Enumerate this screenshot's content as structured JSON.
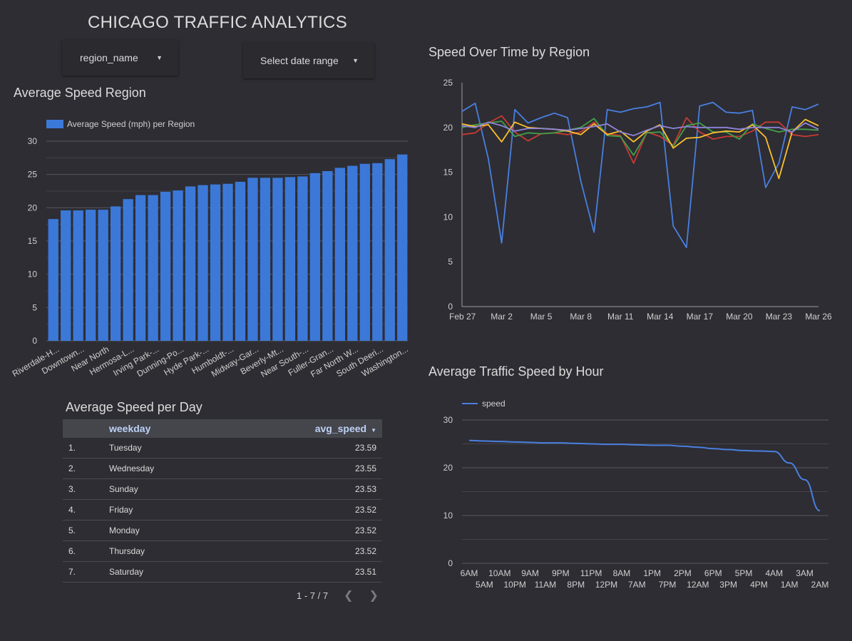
{
  "title": "CHICAGO TRAFFIC ANALYTICS",
  "filters": {
    "region": {
      "label": "region_name"
    },
    "date": {
      "label": "Select date range"
    }
  },
  "region_chart": {
    "title": "Average Speed Region",
    "legend": "Average Speed (mph) per Region",
    "color": "#3c78d8"
  },
  "time_chart": {
    "title": "Speed Over Time by Region"
  },
  "hour_chart": {
    "title": "Average Traffic Speed by Hour",
    "legend": "speed"
  },
  "table": {
    "title": "Average Speed per Day",
    "headers": {
      "day": "weekday",
      "value": "avg_speed"
    },
    "rows": [
      {
        "idx": "1.",
        "day": "Tuesday",
        "value": "23.59"
      },
      {
        "idx": "2.",
        "day": "Wednesday",
        "value": "23.55"
      },
      {
        "idx": "3.",
        "day": "Sunday",
        "value": "23.53"
      },
      {
        "idx": "4.",
        "day": "Friday",
        "value": "23.52"
      },
      {
        "idx": "5.",
        "day": "Monday",
        "value": "23.52"
      },
      {
        "idx": "6.",
        "day": "Thursday",
        "value": "23.52"
      },
      {
        "idx": "7.",
        "day": "Saturday",
        "value": "23.51"
      }
    ],
    "pagination": "1 - 7 / 7"
  },
  "icons": {
    "dropdown": "caret-down-icon",
    "prev": "chevron-left-icon",
    "next": "chevron-right-icon",
    "sort": "sort-desc-icon"
  },
  "chart_data": [
    {
      "type": "bar",
      "title": "Average Speed Region",
      "legend": [
        "Average Speed (mph) per Region"
      ],
      "ylim": [
        0,
        30
      ],
      "yticks": [
        0,
        5,
        10,
        15,
        20,
        25,
        30
      ],
      "grid": true,
      "legend_position": "top-left",
      "tick_labels": [
        "Riverdale-H...",
        "Downtown...",
        "Near North",
        "Hermosa-L...",
        "Irving Park-...",
        "Dunning-Po...",
        "Hyde Park-...",
        "Humboldt-...",
        "Midway-Gar...",
        "Beverly-Mt...",
        "Near South-...",
        "Fuller-Gran...",
        "Far North W...",
        "South Deeri...",
        "Washington..."
      ],
      "series": [
        {
          "name": "Average Speed (mph) per Region",
          "values": [
            18.3,
            19.6,
            19.6,
            19.7,
            19.7,
            20.2,
            21.3,
            21.9,
            21.9,
            22.4,
            22.6,
            23.2,
            23.4,
            23.5,
            23.6,
            23.9,
            24.5,
            24.5,
            24.5,
            24.6,
            24.7,
            25.2,
            25.5,
            26.0,
            26.3,
            26.6,
            26.7,
            27.3,
            28.0
          ],
          "color": "#3c78d8"
        }
      ]
    },
    {
      "type": "line",
      "title": "Speed Over Time by Region",
      "ylim": [
        0,
        25
      ],
      "yticks": [
        0,
        5,
        10,
        15,
        20,
        25
      ],
      "x_labels": [
        "Feb 27",
        "Mar 2",
        "Mar 5",
        "Mar 8",
        "Mar 11",
        "Mar 14",
        "Mar 17",
        "Mar 20",
        "Mar 23",
        "Mar 26"
      ],
      "grid": false,
      "series": [
        {
          "color": "#4a7fe0",
          "values": [
            21.8,
            22.7,
            16.5,
            7.1,
            22.0,
            20.5,
            21.1,
            21.6,
            21.1,
            14.0,
            8.3,
            22.0,
            21.7,
            22.1,
            22.3,
            22.8,
            9.0,
            6.6,
            22.4,
            22.8,
            21.7,
            21.6,
            21.9,
            13.3,
            16.0,
            22.3,
            22.0,
            22.6
          ]
        },
        {
          "color": "#c83a32",
          "values": [
            19.2,
            19.4,
            20.5,
            21.3,
            19.5,
            18.5,
            19.3,
            19.4,
            19.2,
            19.5,
            20.6,
            19.3,
            19.1,
            16.0,
            19.5,
            19.0,
            18.0,
            21.1,
            19.5,
            18.7,
            19.0,
            19.0,
            19.6,
            20.6,
            20.6,
            19.2,
            19.0,
            19.2
          ]
        },
        {
          "color": "#43a047",
          "values": [
            20.0,
            20.3,
            20.5,
            20.7,
            19.0,
            19.4,
            19.3,
            19.4,
            19.7,
            20.0,
            21.0,
            19.1,
            19.0,
            16.9,
            19.4,
            19.5,
            17.9,
            20.2,
            20.5,
            19.5,
            19.5,
            18.7,
            20.4,
            19.9,
            19.5,
            19.8,
            19.8,
            19.7
          ]
        },
        {
          "color": "#fbc02d",
          "values": [
            20.4,
            20.1,
            20.3,
            18.4,
            20.6,
            20.0,
            19.9,
            19.8,
            19.6,
            19.2,
            20.4,
            19.2,
            19.6,
            18.4,
            19.6,
            20.3,
            17.7,
            18.8,
            18.9,
            19.4,
            19.6,
            19.5,
            20.3,
            18.9,
            14.3,
            19.5,
            20.9,
            20.2
          ]
        },
        {
          "color": "#8e84d8",
          "values": [
            20.2,
            20.0,
            20.6,
            20.2,
            19.6,
            19.9,
            19.9,
            19.8,
            19.7,
            19.9,
            20.1,
            20.4,
            19.5,
            19.1,
            19.7,
            20.2,
            19.9,
            20.1,
            20.0,
            20.0,
            20.0,
            19.8,
            20.0,
            20.0,
            20.0,
            19.5,
            20.5,
            19.8
          ]
        }
      ]
    },
    {
      "type": "line",
      "title": "Average Traffic Speed by Hour",
      "legend": [
        "speed"
      ],
      "legend_position": "top-left",
      "ylim": [
        0,
        30
      ],
      "yticks": [
        0,
        10,
        20,
        30
      ],
      "grid": true,
      "x": [
        "6AM",
        "5AM",
        "10AM",
        "10PM",
        "9AM",
        "11AM",
        "9PM",
        "8PM",
        "11PM",
        "12PM",
        "8AM",
        "7AM",
        "1PM",
        "7PM",
        "2PM",
        "12AM",
        "6PM",
        "3PM",
        "5PM",
        "4PM",
        "4AM",
        "1AM",
        "3AM",
        "2AM"
      ],
      "series": [
        {
          "name": "speed",
          "color": "#4a7fe0",
          "values": [
            25.7,
            25.6,
            25.5,
            25.4,
            25.3,
            25.2,
            25.2,
            25.1,
            25.0,
            24.9,
            24.9,
            24.8,
            24.7,
            24.7,
            24.5,
            24.3,
            24.0,
            23.8,
            23.6,
            23.5,
            23.4,
            21.0,
            17.5,
            11.0
          ]
        }
      ]
    }
  ]
}
